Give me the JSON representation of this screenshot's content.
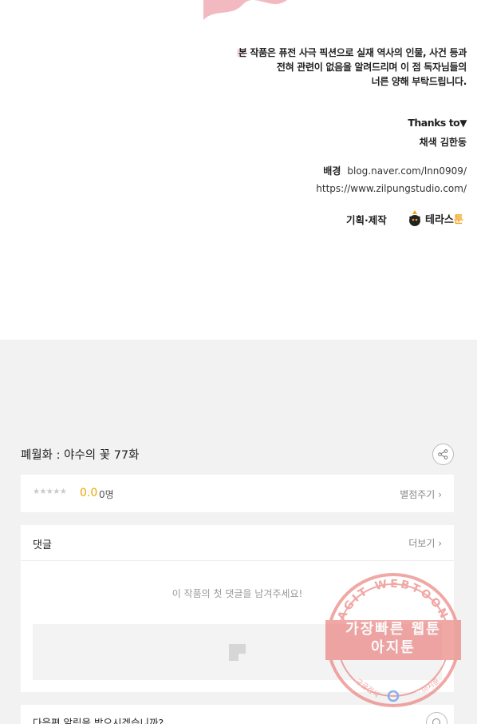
{
  "artwork": {
    "notice_lines": [
      "본 작품은 퓨전 사극 픽션으로 실재 역사의 인물, 사건 등과",
      "전혀 관련이 없음을 알려드리며 이 점 독자님들의",
      "너른 양해 부탁드립니다."
    ],
    "thanks": "Thanks to",
    "thanks_arrow": "▼",
    "colorist": "채색 김한동",
    "background_label": "배경",
    "background_url": "blog.naver.com/lnn0909/",
    "studio_url": "https://www.zilpungstudio.com/",
    "production_label": "기획·제작",
    "brand_name": "테라스",
    "brand_suffix": "툰",
    "splash_color": "#f3b9c1"
  },
  "episode": {
    "title": "폐월화 : 야수의 꽃 77화",
    "share_icon": "share-icon"
  },
  "rating": {
    "stars": "★★★★★",
    "score": "0.0",
    "count": "0명",
    "rate_button": "별점주기",
    "chevron": "›"
  },
  "comments": {
    "label": "댓글",
    "more_button": "더보기",
    "chevron": "›",
    "empty_message": "이 작품의 첫 댓글을 남겨주세요!",
    "input_icon": "sticker-icon"
  },
  "notify": {
    "text": "다음편 알림을 받으시겠습니까?",
    "icon": "bell-icon"
  },
  "watermark": {
    "ring_text": "AGIT WEBTOON",
    "line1": "가장빠른 웹툰",
    "line2": "아지툰",
    "bottom_left": "구글검색",
    "bottom_right": "아지툰",
    "color": "#e8736f"
  }
}
